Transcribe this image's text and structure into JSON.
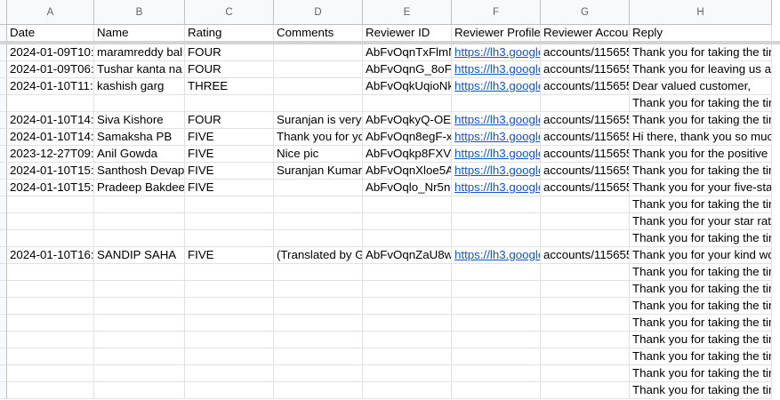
{
  "columns": [
    "A",
    "B",
    "C",
    "D",
    "E",
    "F",
    "G",
    "H"
  ],
  "headers": [
    "Date",
    "Name",
    "Rating",
    "Comments",
    "Reviewer ID",
    "Reviewer Profile",
    "Reviewer Account",
    "Reply"
  ],
  "rows": [
    {
      "date": "2024-01-09T10:",
      "name": "maramreddy bal",
      "rating": "FOUR",
      "comments": "",
      "rid": "AbFvOqnTxFlmN",
      "profile": "https://lh3.google",
      "account": "accounts/115655",
      "reply": "Thank you for taking the tim"
    },
    {
      "date": "2024-01-09T06:",
      "name": "Tushar kanta na",
      "rating": "FOUR",
      "comments": "",
      "rid": "AbFvOqnG_8oF",
      "profile": "https://lh3.google",
      "account": "accounts/115655",
      "reply": "Thank you for leaving us a"
    },
    {
      "date": "2024-01-10T11:",
      "name": "kashish garg",
      "rating": "THREE",
      "comments": "",
      "rid": "AbFvOqkUqioNk",
      "profile": "https://lh3.google",
      "account": "accounts/115655",
      "reply": "Dear valued customer,"
    },
    {
      "date": "",
      "name": "",
      "rating": "",
      "comments": "",
      "rid": "",
      "profile": "",
      "account": "",
      "reply": "Thank you for taking the tim"
    },
    {
      "date": "2024-01-10T14:",
      "name": "Siva Kishore",
      "rating": "FOUR",
      "comments": "Suranjan is very",
      "rid": "AbFvOqkyQ-OE",
      "profile": "https://lh3.google",
      "account": "accounts/115655",
      "reply": "Thank you for taking the tim"
    },
    {
      "date": "2024-01-10T14:",
      "name": "Samaksha PB",
      "rating": "FIVE",
      "comments": "Thank you for yo",
      "rid": "AbFvOqn8egF-x",
      "profile": "https://lh3.google",
      "account": "accounts/115655",
      "reply": "Hi there, thank you so much"
    },
    {
      "date": "2023-12-27T09:",
      "name": "Anil Gowda",
      "rating": "FIVE",
      "comments": "Nice pic",
      "rid": "AbFvOqkp8FXV",
      "profile": "https://lh3.google",
      "account": "accounts/115655",
      "reply": "Thank you for the positive r"
    },
    {
      "date": "2024-01-10T15:",
      "name": "Santhosh Devap",
      "rating": "FIVE",
      "comments": "Suranjan Kumar",
      "rid": "AbFvOqnXloe5A",
      "profile": "https://lh3.google",
      "account": "accounts/115655",
      "reply": "Thank you for taking the tim"
    },
    {
      "date": "2024-01-10T15:",
      "name": "Pradeep Bakdee",
      "rating": "FIVE",
      "comments": "",
      "rid": "AbFvOqlo_Nr5n",
      "profile": "https://lh3.google",
      "account": "accounts/115655",
      "reply": "Thank you for your five-star"
    },
    {
      "date": "",
      "name": "",
      "rating": "",
      "comments": "",
      "rid": "",
      "profile": "",
      "account": "",
      "reply": "Thank you for taking the tim"
    },
    {
      "date": "",
      "name": "",
      "rating": "",
      "comments": "",
      "rid": "",
      "profile": "",
      "account": "",
      "reply": "Thank you for your star rati"
    },
    {
      "date": "",
      "name": "",
      "rating": "",
      "comments": "",
      "rid": "",
      "profile": "",
      "account": "",
      "reply": "Thank you for taking the tim"
    },
    {
      "date": "2024-01-10T16:",
      "name": "SANDIP SAHA",
      "rating": "FIVE",
      "comments": "(Translated by G",
      "rid": "AbFvOqnZaU8w",
      "profile": "https://lh3.google",
      "account": "accounts/115655",
      "reply": "Thank you for your kind wo"
    },
    {
      "date": "",
      "name": "",
      "rating": "",
      "comments": "",
      "rid": "",
      "profile": "",
      "account": "",
      "reply": "Thank you for taking the tim"
    },
    {
      "date": "",
      "name": "",
      "rating": "",
      "comments": "",
      "rid": "",
      "profile": "",
      "account": "",
      "reply": "Thank you for taking the tim"
    },
    {
      "date": "",
      "name": "",
      "rating": "",
      "comments": "",
      "rid": "",
      "profile": "",
      "account": "",
      "reply": "Thank you for taking the tim"
    },
    {
      "date": "",
      "name": "",
      "rating": "",
      "comments": "",
      "rid": "",
      "profile": "",
      "account": "",
      "reply": "Thank you for taking the tim"
    },
    {
      "date": "",
      "name": "",
      "rating": "",
      "comments": "",
      "rid": "",
      "profile": "",
      "account": "",
      "reply": "Thank you for taking the tim"
    },
    {
      "date": "",
      "name": "",
      "rating": "",
      "comments": "",
      "rid": "",
      "profile": "",
      "account": "",
      "reply": "Thank you for taking the tim"
    },
    {
      "date": "",
      "name": "",
      "rating": "",
      "comments": "",
      "rid": "",
      "profile": "",
      "account": "",
      "reply": "Thank you for taking the tim"
    },
    {
      "date": "",
      "name": "",
      "rating": "",
      "comments": "",
      "rid": "",
      "profile": "",
      "account": "",
      "reply": "Thank you for taking the tim"
    }
  ],
  "colors": {
    "link": "#1155cc",
    "header_bg": "#f8f9fa",
    "grid": "#e2e2e2",
    "freeze": "#d4d4d4"
  }
}
